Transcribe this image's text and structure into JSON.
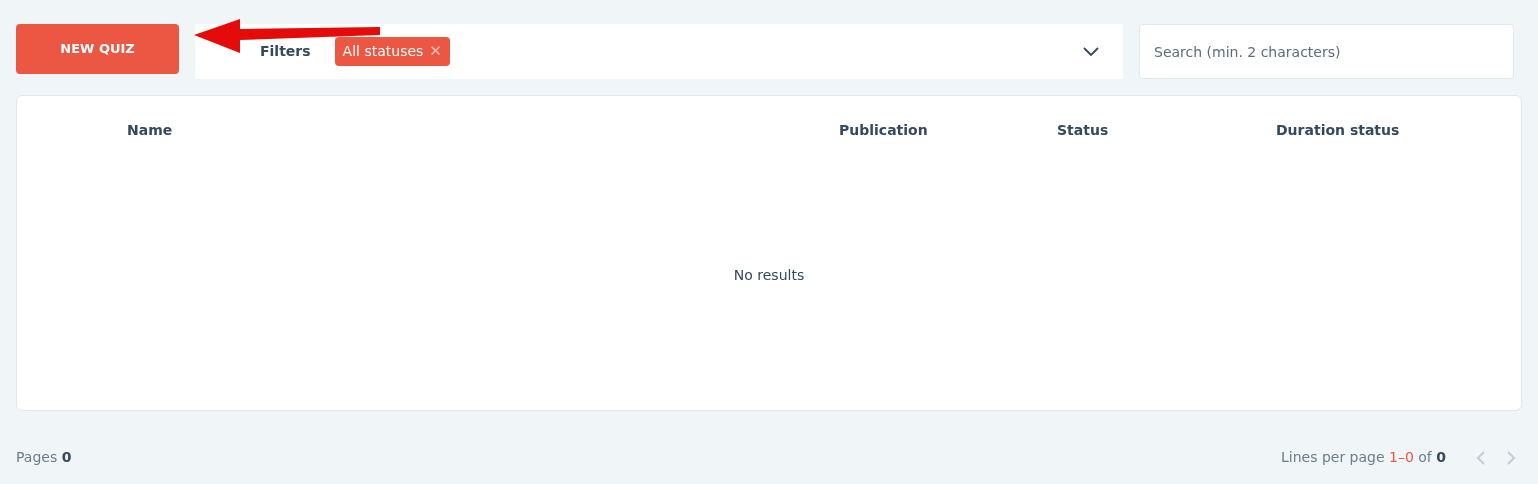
{
  "toolbar": {
    "new_button": "NEW QUIZ",
    "filters_label": "Filters",
    "filter_chips": [
      {
        "label": "All statuses",
        "remove": "✕"
      }
    ],
    "search": {
      "placeholder": "Search (min. 2 characters)"
    }
  },
  "annotation": {
    "kind": "arrow",
    "color": "#e50b0b"
  },
  "table": {
    "columns": [
      "Name",
      "Publication",
      "Status",
      "Duration status"
    ],
    "empty_message": "No results"
  },
  "footer": {
    "pages_label": "Pages",
    "pages_value": "0",
    "lines_label": "Lines per page",
    "range": "1–0",
    "of": "of",
    "total": "0",
    "prev_disabled": true,
    "next_disabled": true
  }
}
